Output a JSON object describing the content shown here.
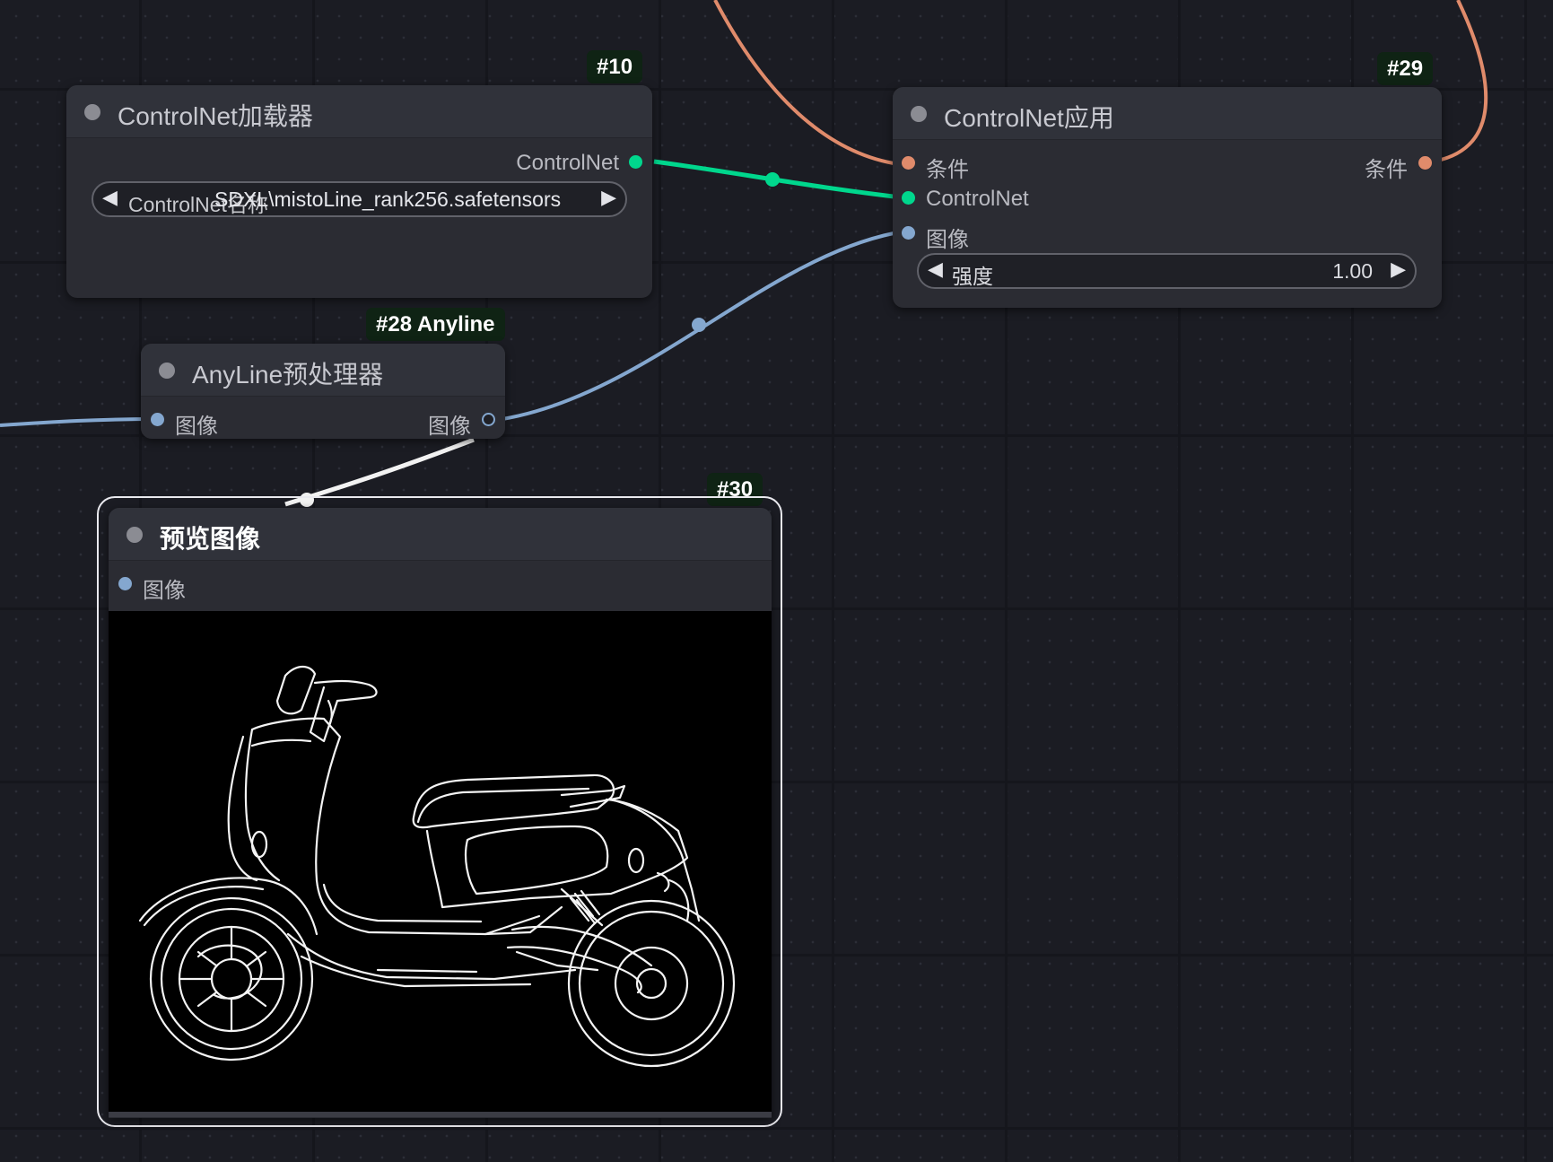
{
  "nodes": {
    "loader": {
      "badge": "#10",
      "title": "ControlNet加载器",
      "output_label": "ControlNet",
      "widget_value": "ControlNet名称",
      "widget_value_overlay": "SDXL\\mistoLine_rank256.safetensors"
    },
    "apply": {
      "badge": "#29",
      "title": "ControlNet应用",
      "input_conditioning": "条件",
      "input_controlnet": "ControlNet",
      "input_image": "图像",
      "output_conditioning": "条件",
      "strength_label": "强度",
      "strength_value": "1.00"
    },
    "anyline": {
      "badge": "#28 Anyline",
      "title": "AnyLine预处理器",
      "input_image": "图像",
      "output_image": "图像"
    },
    "preview": {
      "badge": "#30",
      "title": "预览图像",
      "input_image": "图像"
    }
  },
  "colors": {
    "conditioning": "#e08b6b",
    "controlnet": "#00d78d",
    "image": "#84a7cf",
    "canvas": "#1b1c23",
    "node_body": "#2b2c33",
    "badge_bg": "#0f2314"
  },
  "icons": {
    "collapse": "circle-dot",
    "prev": "left-triangle",
    "next": "right-triangle"
  }
}
